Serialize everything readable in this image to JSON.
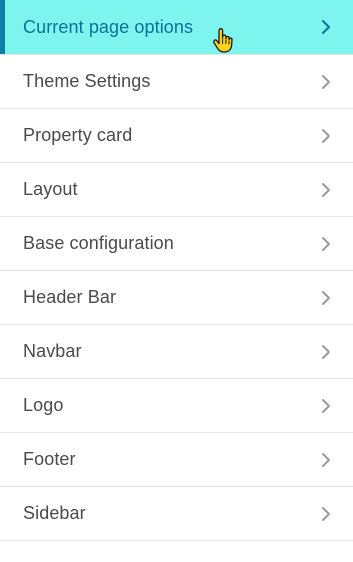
{
  "menu": {
    "items": [
      {
        "label": "Current page options",
        "active": true
      },
      {
        "label": "Theme Settings",
        "active": false
      },
      {
        "label": "Property card",
        "active": false
      },
      {
        "label": "Layout",
        "active": false
      },
      {
        "label": "Base configuration",
        "active": false
      },
      {
        "label": "Header Bar",
        "active": false
      },
      {
        "label": "Navbar",
        "active": false
      },
      {
        "label": "Logo",
        "active": false
      },
      {
        "label": "Footer",
        "active": false
      },
      {
        "label": "Sidebar",
        "active": false
      }
    ],
    "item_icon": "chevron-right-icon"
  },
  "colors": {
    "active_background": "#7df5ee",
    "active_accent": "#0f7fa8",
    "active_text": "#0f6f98",
    "text": "#4a4a4a",
    "chevron": "#9a9a9a",
    "chevron_active": "#0f6f98",
    "divider": "#e6e6e6"
  },
  "cursor": {
    "icon": "hand-pointer-icon"
  }
}
